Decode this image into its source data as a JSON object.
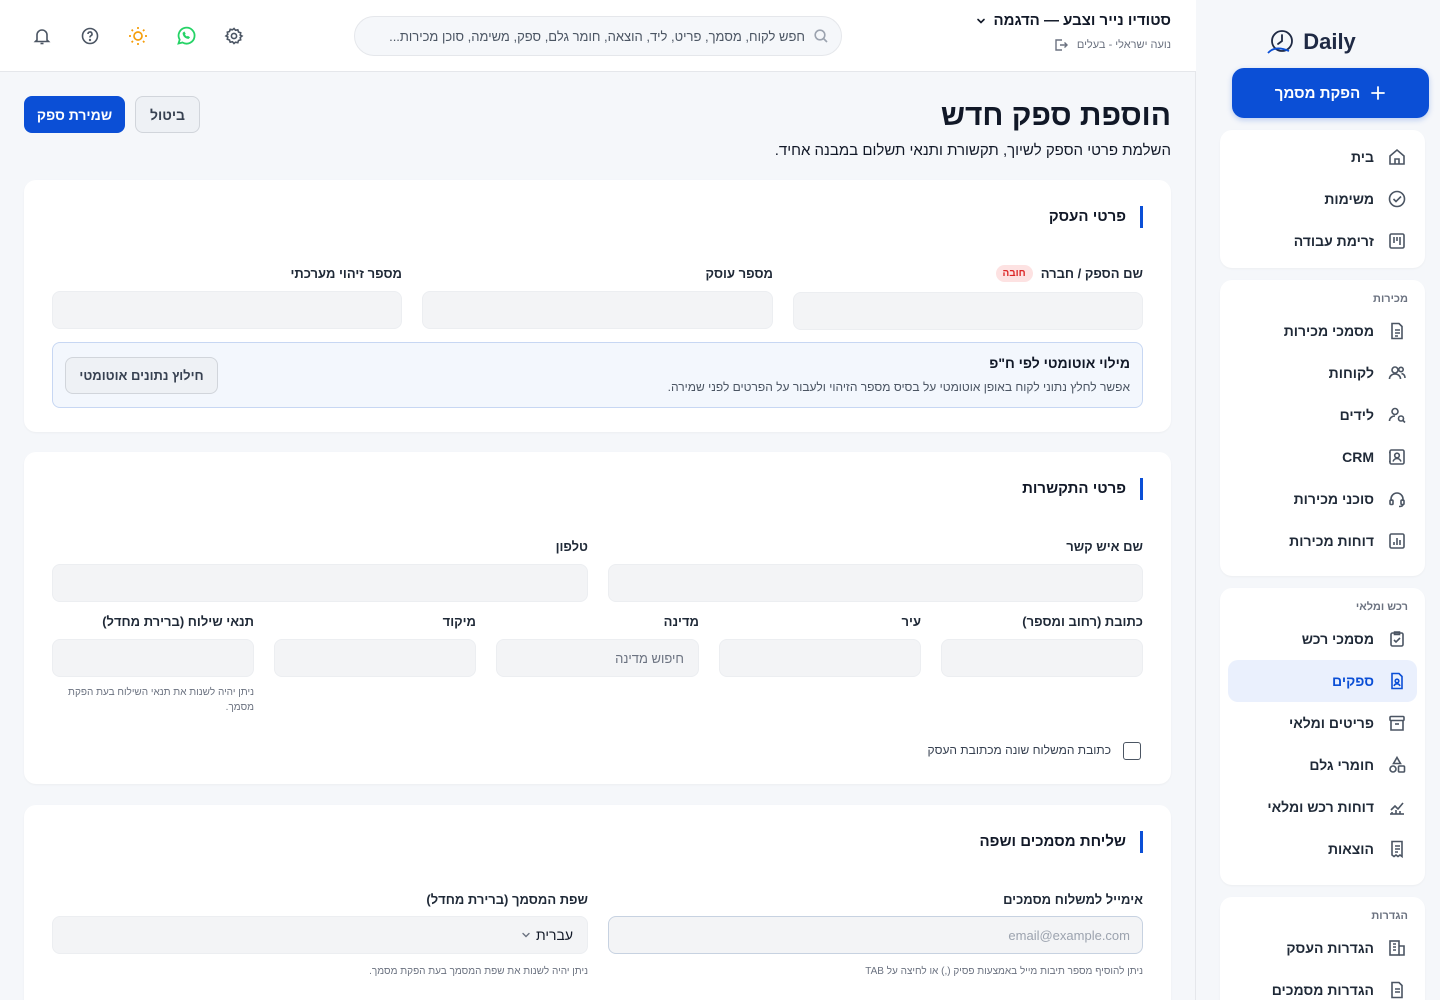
{
  "brand": {
    "name": "Daily"
  },
  "sidebar": {
    "cta_label": "הפקת מסמך",
    "groups": [
      {
        "title": "",
        "items": [
          {
            "label": "בית",
            "icon": "home-icon"
          },
          {
            "label": "משימות",
            "icon": "check-circle-icon"
          },
          {
            "label": "זרימת עבודה",
            "icon": "kanban-icon"
          }
        ]
      },
      {
        "title": "מכירות",
        "items": [
          {
            "label": "מסמכי מכירות",
            "icon": "document-icon"
          },
          {
            "label": "לקוחות",
            "icon": "users-icon"
          },
          {
            "label": "לידים",
            "icon": "user-search-icon"
          },
          {
            "label": "CRM",
            "icon": "contact-card-icon"
          },
          {
            "label": "סוכני מכירות",
            "icon": "headset-icon"
          },
          {
            "label": "דוחות מכירות",
            "icon": "bar-chart-icon"
          }
        ]
      },
      {
        "title": "רכש ומלאי",
        "items": [
          {
            "label": "מסמכי רכש",
            "icon": "clipboard-check-icon"
          },
          {
            "label": "ספקים",
            "icon": "supplier-file-icon",
            "active": true
          },
          {
            "label": "פריטים ומלאי",
            "icon": "archive-icon"
          },
          {
            "label": "חומרי גלם",
            "icon": "shapes-icon"
          },
          {
            "label": "דוחות רכש ומלאי",
            "icon": "line-chart-icon"
          },
          {
            "label": "הוצאות",
            "icon": "receipt-icon"
          }
        ]
      },
      {
        "title": "הגדרות",
        "items": [
          {
            "label": "הגדרות העסק",
            "icon": "building-icon"
          },
          {
            "label": "הגדרות מסמכים",
            "icon": "document-settings-icon"
          }
        ]
      }
    ]
  },
  "header": {
    "business_name": "סטודיו נייר וצבע — הדגמה",
    "user_line": "נועה ישראלי - בעלים",
    "search_placeholder": "חפש לקוח, מסמך, פריט, ליד, הוצאה, חומר גלם, ספק, משימה, סוכן מכירות...",
    "colors": {
      "whatsapp": "#25d366",
      "sun": "#f59e0b"
    }
  },
  "page": {
    "title": "הוספת ספק חדש",
    "subtitle": "השלמת פרטי הספק לשיוך, תקשורת ותנאי תשלום במבנה אחיד.",
    "save_label": "שמירת ספק",
    "cancel_label": "ביטול",
    "accent": "#0b4fd6"
  },
  "business_section": {
    "title": "פרטי העסק",
    "name_label": "שם הספק / חברה",
    "required_badge": "חובה",
    "dealer_label": "מספר עוסק",
    "system_id_label": "מספר זיהוי מערכתי",
    "autofill": {
      "title": "מילוי אוטומטי לפי ח\"פ",
      "description": "אפשר לחלץ נתוני לקוח באופן אוטומטי על בסיס מספר הזיהוי ולעבור על הפרטים לפני שמירה.",
      "button_label": "חילוץ נתונים אוטומטי"
    }
  },
  "contact_section": {
    "title": "פרטי התקשרות",
    "contact_name_label": "שם איש קשר",
    "phone_label": "טלפון",
    "address_label": "כתובת (רחוב ומספר)",
    "city_label": "עיר",
    "country_label": "מדינה",
    "country_placeholder": "חיפוש מדינה",
    "zip_label": "מיקוד",
    "shipping_terms_label": "תנאי שילוח (ברירת מחדל)",
    "shipping_terms_hint": "ניתן יהיה לשנות את תנאי השילוח בעת הפקת מסמך.",
    "diff_address_label": "כתובת המשלוח שונה מכתובת העסק"
  },
  "docs_section": {
    "title": "שליחת מסמכים ושפה",
    "email_label": "אימייל למשלוח מסמכים",
    "email_placeholder": "email@example.com",
    "email_hint": "ניתן להוסיף מספר תיבות מייל באמצעות פסיק (,) או לחיצה על TAB",
    "language_label": "שפת המסמך (ברירת מחדל)",
    "language_value": "עברית",
    "language_hint": "ניתן יהיה לשנות את שפת המסמך בעת הפקת מסמך."
  }
}
